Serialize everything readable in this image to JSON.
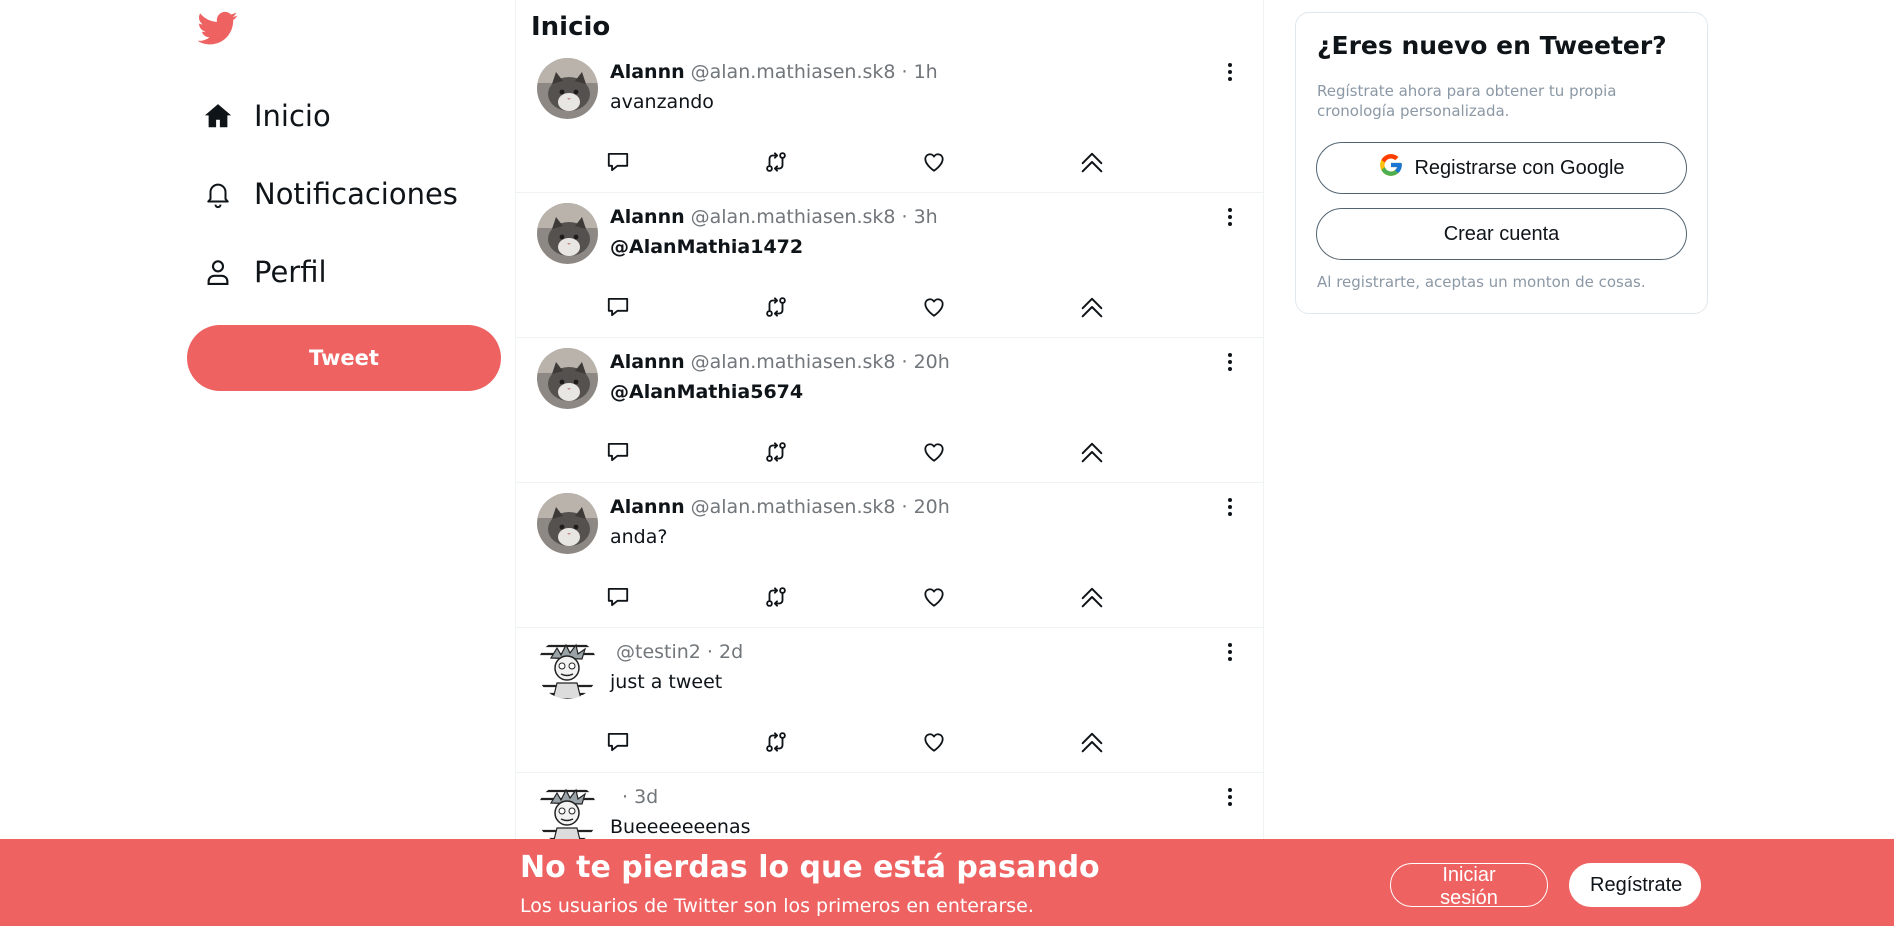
{
  "brand": {
    "accent": "#ee6262",
    "logo_icon": "bird-icon"
  },
  "nav": [
    {
      "label": "Inicio",
      "icon": "home-icon"
    },
    {
      "label": "Notificaciones",
      "icon": "bell-icon"
    },
    {
      "label": "Perfil",
      "icon": "user-icon"
    }
  ],
  "tweet_button": "Tweet",
  "feed": {
    "title": "Inicio",
    "tweets": [
      {
        "name": "Alannn",
        "handle": "@alan.mathiasen.sk8",
        "time": "· 1h",
        "text": "avanzando",
        "avatar": "cat-avatar"
      },
      {
        "name": "Alannn",
        "handle": "@alan.mathiasen.sk8",
        "time": "· 3h",
        "text": "@AlanMathia1472",
        "avatar": "cat-avatar"
      },
      {
        "name": "Alannn",
        "handle": "@alan.mathiasen.sk8",
        "time": "· 20h",
        "text": "@AlanMathia5674",
        "avatar": "cat-avatar"
      },
      {
        "name": "Alannn",
        "handle": "@alan.mathiasen.sk8",
        "time": "· 20h",
        "text": "anda?",
        "avatar": "cat-avatar"
      },
      {
        "name": "",
        "handle": "@testin2",
        "time": "· 2d",
        "text": "just a tweet",
        "avatar": "cartoon-avatar"
      },
      {
        "name": "",
        "handle": "",
        "time": "· 3d",
        "text": "Bueeeeeeenas",
        "avatar": "cartoon-avatar"
      }
    ]
  },
  "signup_card": {
    "title": "¿Eres nuevo en Tweeter?",
    "description": "Regístrate ahora para obtener tu propia cronología personalizada.",
    "google_button": "Registrarse con Google",
    "create_button": "Crear cuenta",
    "footer": "Al registrarte, aceptas un monton de cosas."
  },
  "banner": {
    "title": "No te pierdas lo que está pasando",
    "subtitle": "Los usuarios de Twitter son los primeros en enterarse.",
    "login_button": "Iniciar sesión",
    "register_button": "Regístrate"
  }
}
